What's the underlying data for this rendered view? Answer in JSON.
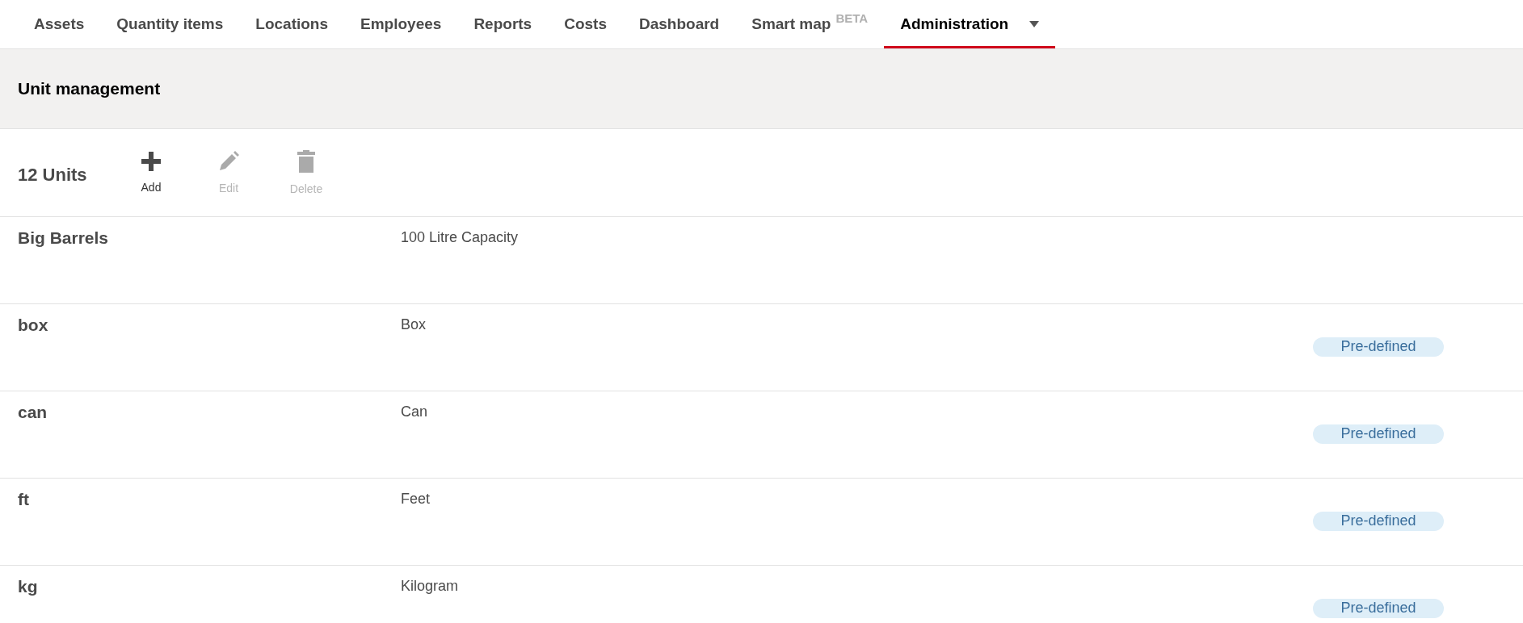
{
  "tabs": [
    {
      "label": "Assets",
      "selected": false,
      "menu": false
    },
    {
      "label": "Quantity items",
      "selected": false,
      "menu": false
    },
    {
      "label": "Locations",
      "selected": false,
      "menu": false
    },
    {
      "label": "Employees",
      "selected": false,
      "menu": false
    },
    {
      "label": "Reports",
      "selected": false,
      "menu": false
    },
    {
      "label": "Costs",
      "selected": false,
      "menu": false
    },
    {
      "label": "Dashboard",
      "selected": false,
      "menu": false
    },
    {
      "label": "Smart map",
      "tag": "BETA",
      "selected": false,
      "menu": false
    },
    {
      "label": "Administration",
      "selected": true,
      "menu": true
    }
  ],
  "page": {
    "title": "Unit management"
  },
  "toolbar": {
    "count": "12 Units",
    "actions": [
      {
        "kind": "add",
        "label": "Add",
        "disabled": false
      },
      {
        "kind": "edit",
        "label": "Edit",
        "disabled": true
      },
      {
        "kind": "delete",
        "label": "Delete",
        "disabled": true
      }
    ]
  },
  "units": [
    {
      "name": "Big Barrels",
      "description": "100 Litre Capacity"
    },
    {
      "name": "box",
      "description": "Box",
      "badge": "Pre-defined"
    },
    {
      "name": "can",
      "description": "Can",
      "badge": "Pre-defined"
    },
    {
      "name": "ft",
      "description": "Feet",
      "badge": "Pre-defined"
    },
    {
      "name": "kg",
      "description": "Kilogram",
      "badge": "Pre-defined"
    }
  ]
}
